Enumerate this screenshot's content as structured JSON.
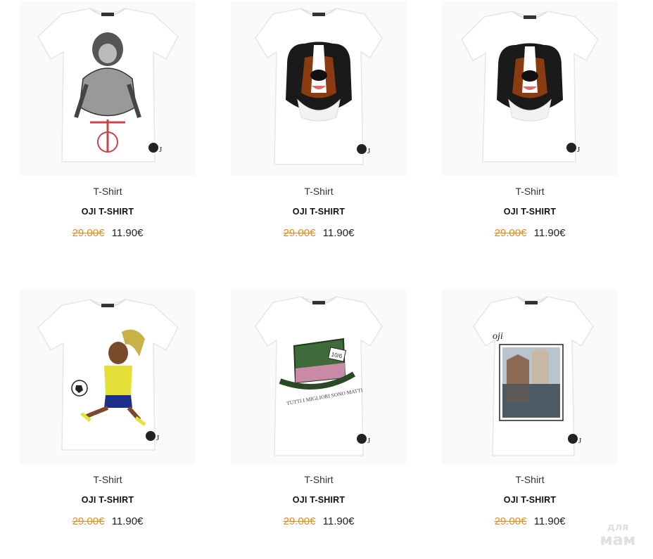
{
  "products": [
    {
      "category": "T-Shirt",
      "title": "OJI T-SHIRT",
      "old_price": "29.00€",
      "new_price": "11.90€",
      "print": "chimp-on-bicycle"
    },
    {
      "category": "T-Shirt",
      "title": "OJI T-SHIRT",
      "old_price": "29.00€",
      "new_price": "11.90€",
      "print": "bernese-dog"
    },
    {
      "category": "T-Shirt",
      "title": "OJI T-SHIRT",
      "old_price": "29.00€",
      "new_price": "11.90€",
      "print": "bernese-dog"
    },
    {
      "category": "T-Shirt",
      "title": "OJI T-SHIRT",
      "old_price": "29.00€",
      "new_price": "11.90€",
      "print": "soccer-player"
    },
    {
      "category": "T-Shirt",
      "title": "OJI T-SHIRT",
      "old_price": "29.00€",
      "new_price": "11.90€",
      "print": "mad-hatter-hat",
      "print_text": "TUTTI I MIGLIORI SONO MATTI"
    },
    {
      "category": "T-Shirt",
      "title": "OJI T-SHIRT",
      "old_price": "29.00€",
      "new_price": "11.90€",
      "print": "florence-photo",
      "print_text": "oji"
    }
  ],
  "watermark": {
    "line1": "для",
    "line2": "мам"
  },
  "colors": {
    "old_price": "#e58a1f",
    "new_price": "#222222",
    "shirt": "#ffffff"
  }
}
